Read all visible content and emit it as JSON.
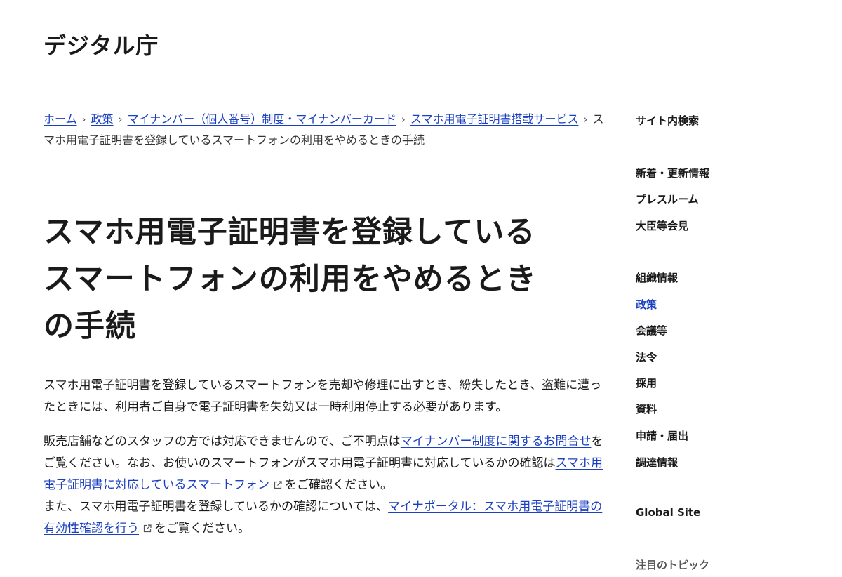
{
  "header": {
    "logo": "デジタル庁"
  },
  "breadcrumb": {
    "items": [
      {
        "label": "ホーム"
      },
      {
        "label": "政策"
      },
      {
        "label": "マイナンバー（個人番号）制度・マイナンバーカード"
      },
      {
        "label": "スマホ用電子証明書搭載サービス"
      }
    ],
    "current": "スマホ用電子証明書を登録しているスマートフォンの利用をやめるときの手続"
  },
  "main": {
    "title_lines": [
      "スマホ用電子証明書を登録している",
      "スマートフォンの利用をやめるとき",
      "の手続"
    ],
    "p1": "スマホ用電子証明書を登録しているスマートフォンを売却や修理に出すとき、紛失したとき、盗難に遭ったときには、利用者ご自身で電子証明書を失効又は一時利用停止する必要があります。",
    "p2": {
      "t1": "販売店舗などのスタッフの方では対応できませんので、ご不明点は",
      "link1": "マイナンバー制度に関するお問合せ",
      "t2": "をご覧ください。なお、お使いのスマートフォンがスマホ用電子証明書に対応しているかの確認は",
      "link2": "スマホ用電子証明書に対応しているスマートフォン",
      "t3": "をご確認ください。",
      "t4": "また、スマホ用電子証明書を登録しているかの確認については、",
      "link3": "マイナポータル：スマホ用電子証明書の有効性確認を行う",
      "t5": "をご覧ください。"
    }
  },
  "sidebar": {
    "search": "サイト内検索",
    "news": "新着・更新情報",
    "press": "プレスルーム",
    "minister": "大臣等会見",
    "org": "組織情報",
    "policy": "政策",
    "meetings": "会議等",
    "laws": "法令",
    "recruit": "採用",
    "resources": "資料",
    "applications": "申請・届出",
    "procurement": "調達情報",
    "global": "Global Site",
    "topics": "注目のトピック"
  },
  "colors": {
    "link": "#1a3fc0",
    "text": "#1a1a1a"
  },
  "icons": {
    "external_link": "external-link-icon",
    "breadcrumb_separator": "chevron-right-icon"
  }
}
